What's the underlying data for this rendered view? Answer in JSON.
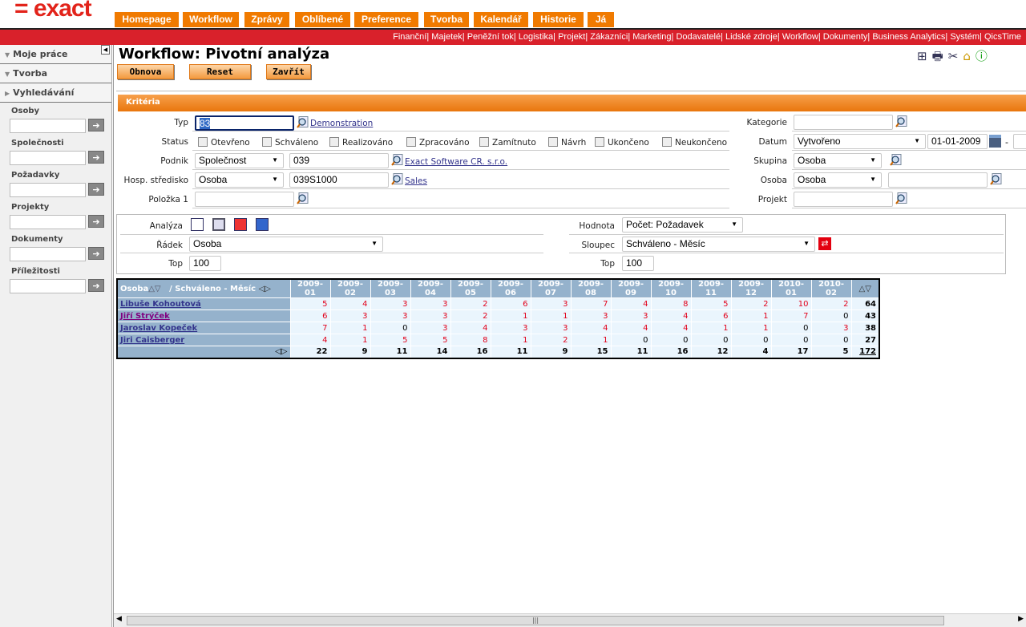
{
  "logo": "= exact",
  "tabs": [
    "Homepage",
    "Workflow",
    "Zprávy",
    "Oblíbené",
    "Preference",
    "Tvorba",
    "Kalendář",
    "Historie",
    "Já"
  ],
  "modules": [
    "Finanční",
    "Majetek",
    "Peněžní tok",
    "Logistika",
    "Projekt",
    "Zákazníci",
    "Marketing",
    "Dodavatelé",
    "Lidské zdroje",
    "Workflow",
    "Dokumenty",
    "Business Analytics",
    "Systém",
    "QicsTime"
  ],
  "sidebar": {
    "sections": [
      "Moje práce",
      "Tvorba",
      "Vyhledávání"
    ],
    "searches": [
      "Osoby",
      "Společnosti",
      "Požadavky",
      "Projekty",
      "Dokumenty",
      "Příležitosti"
    ]
  },
  "page": {
    "title": "Workflow: Pivotní analýza",
    "buttons": [
      "Obnova",
      "Reset",
      "Zavřít"
    ],
    "criteria_title": "Kritéria"
  },
  "criteria": {
    "typ": {
      "label": "Typ",
      "value": "83",
      "link": "Demonstration"
    },
    "status": {
      "label": "Status",
      "options": [
        "Otevřeno",
        "Schváleno",
        "Realizováno",
        "Zpracováno",
        "Zamítnuto",
        "Návrh",
        "Ukončeno",
        "Neukončeno"
      ]
    },
    "podnik": {
      "label": "Podnik",
      "select": "Společnost",
      "value": "039",
      "link": "Exact Software CR. s.r.o."
    },
    "hosp": {
      "label": "Hosp. středisko",
      "select": "Osoba",
      "value": "039S1000",
      "link": "Sales"
    },
    "polozka": {
      "label": "Položka 1",
      "value": ""
    },
    "kategorie": {
      "label": "Kategorie",
      "value": ""
    },
    "datum": {
      "label": "Datum",
      "select": "Vytvořeno",
      "from": "01-01-2009",
      "sep": "-"
    },
    "skupina": {
      "label": "Skupina",
      "select": "Osoba"
    },
    "osoba": {
      "label": "Osoba",
      "select": "Osoba",
      "value": ""
    },
    "projekt": {
      "label": "Projekt",
      "value": ""
    }
  },
  "analysis": {
    "analyza_label": "Analýza",
    "radek_label": "Řádek",
    "radek": "Osoba",
    "top_label": "Top",
    "top": "100",
    "hodnota_label": "Hodnota",
    "hodnota": "Počet: Požadavek",
    "sloupec_label": "Sloupec",
    "sloupec": "Schváleno - Měsíc",
    "top2_label": "Top",
    "top2": "100"
  },
  "pivot": {
    "row_header": "Osoba",
    "col_header": "/ Schváleno - Měsíc",
    "columns": [
      "2009-01",
      "2009-02",
      "2009-03",
      "2009-04",
      "2009-05",
      "2009-06",
      "2009-07",
      "2009-08",
      "2009-09",
      "2009-10",
      "2009-11",
      "2009-12",
      "2010-01",
      "2010-02"
    ],
    "rows": [
      {
        "name": "Libuše Kohoutová",
        "values": [
          5,
          4,
          3,
          3,
          2,
          6,
          3,
          7,
          4,
          8,
          5,
          2,
          10,
          2
        ],
        "total": 64
      },
      {
        "name": "Jiří Strýček",
        "values": [
          6,
          3,
          3,
          3,
          2,
          1,
          1,
          3,
          3,
          4,
          6,
          1,
          7,
          0
        ],
        "total": 43
      },
      {
        "name": "Jaroslav Kopeček",
        "values": [
          7,
          1,
          0,
          3,
          4,
          3,
          3,
          4,
          4,
          4,
          1,
          1,
          0,
          3
        ],
        "total": 38
      },
      {
        "name": "Jiri Caisberger",
        "values": [
          4,
          1,
          5,
          5,
          8,
          1,
          2,
          1,
          0,
          0,
          0,
          0,
          0,
          0
        ],
        "total": 27
      }
    ],
    "totals": [
      22,
      9,
      11,
      14,
      16,
      11,
      9,
      15,
      11,
      16,
      12,
      4,
      17,
      5
    ],
    "grand_total": 172
  },
  "colors": {
    "orange": "#f07a00",
    "red": "#d9212b",
    "header_blue": "#95b2cc"
  }
}
